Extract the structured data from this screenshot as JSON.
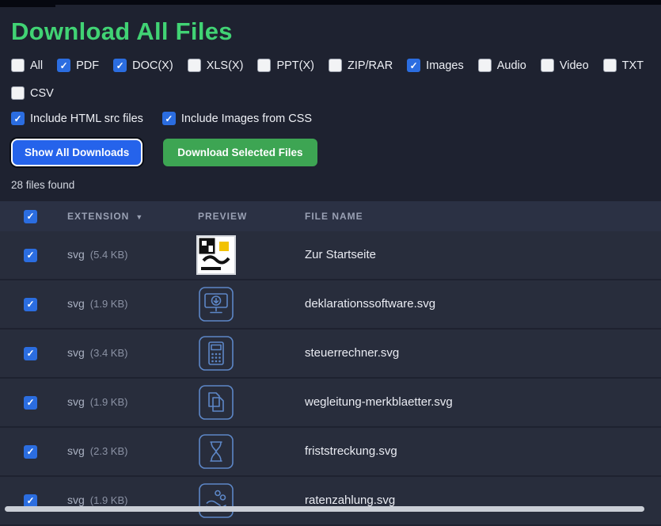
{
  "page": {
    "title": "Download All Files",
    "files_found": "28 files found"
  },
  "glyphs": {
    "check": "✓"
  },
  "filters": [
    {
      "label": "All",
      "checked": false
    },
    {
      "label": "PDF",
      "checked": true
    },
    {
      "label": "DOC(X)",
      "checked": true
    },
    {
      "label": "XLS(X)",
      "checked": false
    },
    {
      "label": "PPT(X)",
      "checked": false
    },
    {
      "label": "ZIP/RAR",
      "checked": false
    },
    {
      "label": "Images",
      "checked": true
    },
    {
      "label": "Audio",
      "checked": false
    },
    {
      "label": "Video",
      "checked": false
    },
    {
      "label": "TXT",
      "checked": false
    },
    {
      "label": "CSV",
      "checked": false
    }
  ],
  "options": [
    {
      "label": "Include HTML src files",
      "checked": true
    },
    {
      "label": "Include Images from CSS",
      "checked": true
    }
  ],
  "buttons": {
    "show_all": "Show All Downloads",
    "download_selected": "Download Selected Files"
  },
  "table": {
    "headers": {
      "extension": "EXTENSION",
      "sort_indicator": "▼",
      "preview": "PREVIEW",
      "filename": "FILE NAME"
    },
    "select_all_checked": true,
    "rows": [
      {
        "checked": true,
        "ext": "svg",
        "size": "(5.4 KB)",
        "icon": "site-logo",
        "name": "Zur Startseite"
      },
      {
        "checked": true,
        "ext": "svg",
        "size": "(1.9 KB)",
        "icon": "monitor-download",
        "name": "deklarationssoftware.svg"
      },
      {
        "checked": true,
        "ext": "svg",
        "size": "(3.4 KB)",
        "icon": "calculator",
        "name": "steuerrechner.svg"
      },
      {
        "checked": true,
        "ext": "svg",
        "size": "(1.9 KB)",
        "icon": "documents",
        "name": "wegleitung-merkblaetter.svg"
      },
      {
        "checked": true,
        "ext": "svg",
        "size": "(2.3 KB)",
        "icon": "hourglass",
        "name": "friststreckung.svg"
      },
      {
        "checked": true,
        "ext": "svg",
        "size": "(1.9 KB)",
        "icon": "hand-coins",
        "name": "ratenzahlung.svg"
      }
    ]
  },
  "colors": {
    "title_green": "#41d374",
    "button_blue": "#2563eb",
    "button_green": "#3da553",
    "checkbox_blue": "#2b6de0",
    "preview_icon_stroke": "#5d87c7",
    "logo_yellow": "#f2c200"
  }
}
